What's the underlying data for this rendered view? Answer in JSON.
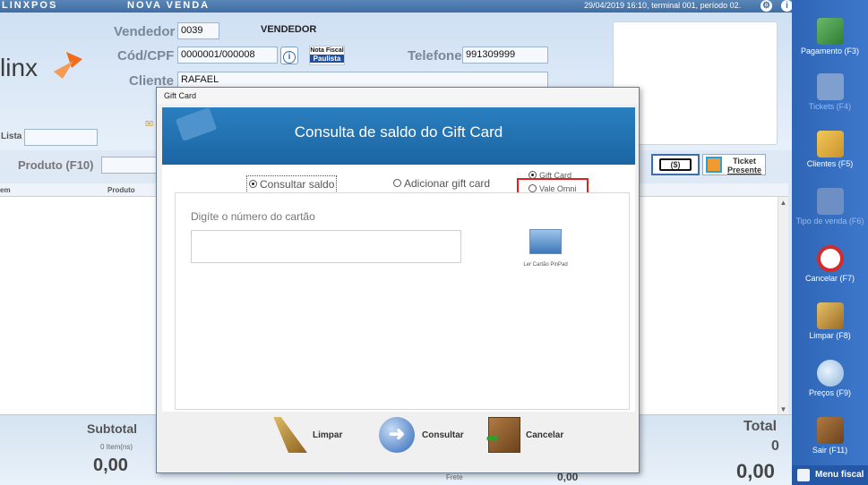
{
  "titlebar": {
    "brand": "LINXPOS",
    "title": "NOVA VENDA",
    "status": "29/04/2019 16:10, terminal 001, período 02."
  },
  "header": {
    "logo_text": "linx",
    "vendedor_label": "Vendedor",
    "vendedor_code": "0039",
    "vendedor_name": "VENDEDOR",
    "cpf_label": "Cód/CPF",
    "cpf_value": "0000001/000008",
    "nfp_line1": "Nota Fiscal",
    "nfp_line2": "Paulista",
    "telefone_label": "Telefone",
    "telefone_value": "991309999",
    "cliente_label": "Cliente",
    "cliente_value": "RAFAEL",
    "lista_label": "Lista",
    "produto_label": "Produto (F10)",
    "ticket_label_1": "Ticket",
    "ticket_label_2": "Presente"
  },
  "grid": {
    "col_item": "em",
    "col_produto": "Produto"
  },
  "footer": {
    "subtotal_label": "Subtotal",
    "items_label": "0 Item(ns)",
    "subtotal_value": "0,00",
    "frete_label": "Frete",
    "frete_value": "0,00",
    "total_label": "Total",
    "total_count": "0",
    "total_value": "0,00"
  },
  "rightpanel": {
    "items": [
      {
        "label": "Pagamento (F3)",
        "icon": "payment-icon",
        "enabled": true
      },
      {
        "label": "Tickets (F4)",
        "icon": "tickets-icon",
        "enabled": false
      },
      {
        "label": "Clientes (F5)",
        "icon": "clients-icon",
        "enabled": true
      },
      {
        "label": "Tipo de venda (F6)",
        "icon": "sale-type-icon",
        "enabled": false
      },
      {
        "label": "Cancelar (F7)",
        "icon": "cancel-icon",
        "enabled": true
      },
      {
        "label": "Limpar (F8)",
        "icon": "broom-icon",
        "enabled": true
      },
      {
        "label": "Preços (F9)",
        "icon": "magnifier-icon",
        "enabled": true
      },
      {
        "label": "Sair (F11)",
        "icon": "exit-door-icon",
        "enabled": true
      }
    ],
    "menu_fiscal": "Menu fiscal"
  },
  "dialog": {
    "window_title": "Gift Card",
    "banner_title": "Consulta de saldo do Gift Card",
    "radio_consultar": "Consultar saldo",
    "radio_adicionar": "Adicionar gift card",
    "radio_giftcard": "Gift Card",
    "radio_valeomni": "Vale Omni",
    "card_prompt": "Digíte o número do cartão",
    "card_value": "",
    "pinpad_label": "Ler Cartão PinPad",
    "btn_limpar": "Limpar",
    "btn_consultar": "Consultar",
    "btn_cancelar": "Cancelar"
  },
  "colors": {
    "accent": "#1c65a3",
    "panel": "#2f65b5",
    "highlight": "#e02020",
    "logo_orange": "#f26a1b"
  }
}
